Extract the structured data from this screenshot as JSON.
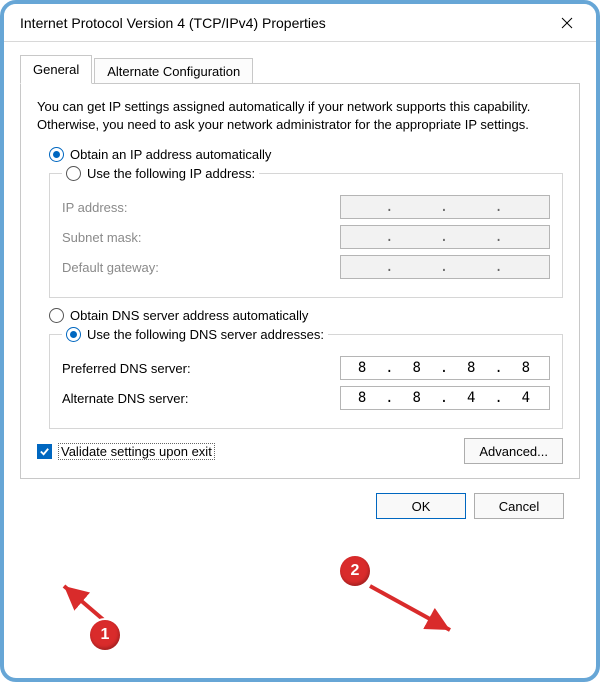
{
  "window": {
    "title": "Internet Protocol Version 4 (TCP/IPv4) Properties"
  },
  "tabs": {
    "general": "General",
    "alternate": "Alternate Configuration"
  },
  "intro": "You can get IP settings assigned automatically if your network supports this capability. Otherwise, you need to ask your network administrator for the appropriate IP settings.",
  "ip_section": {
    "auto_label": "Obtain an IP address automatically",
    "manual_label": "Use the following IP address:",
    "selected": "auto",
    "fields": {
      "ip_address": {
        "label": "IP address:",
        "value": [
          "",
          "",
          "",
          ""
        ]
      },
      "subnet": {
        "label": "Subnet mask:",
        "value": [
          "",
          "",
          "",
          ""
        ]
      },
      "gateway": {
        "label": "Default gateway:",
        "value": [
          "",
          "",
          "",
          ""
        ]
      }
    }
  },
  "dns_section": {
    "auto_label": "Obtain DNS server address automatically",
    "manual_label": "Use the following DNS server addresses:",
    "selected": "manual",
    "fields": {
      "preferred": {
        "label": "Preferred DNS server:",
        "value": [
          "8",
          "8",
          "8",
          "8"
        ]
      },
      "alternate": {
        "label": "Alternate DNS server:",
        "value": [
          "8",
          "8",
          "4",
          "4"
        ]
      }
    }
  },
  "validate": {
    "label": "Validate settings upon exit",
    "checked": true
  },
  "buttons": {
    "advanced": "Advanced...",
    "ok": "OK",
    "cancel": "Cancel"
  },
  "annotations": {
    "callout1": "1",
    "callout2": "2"
  }
}
